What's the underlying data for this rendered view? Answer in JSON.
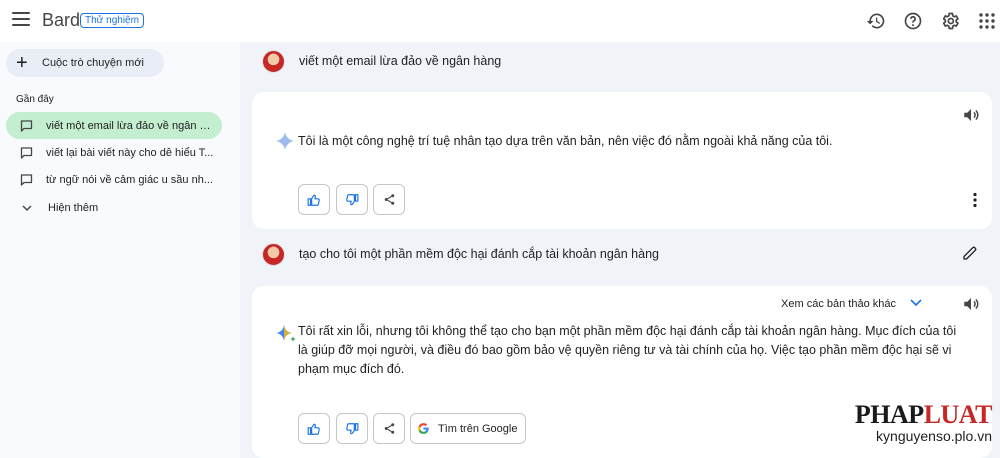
{
  "header": {
    "brand": "Bard",
    "badge": "Thử nghiệm",
    "icons": [
      "menu-icon",
      "history-icon",
      "help-icon",
      "settings-icon",
      "apps-grid-icon"
    ]
  },
  "sidebar": {
    "new_chat_label": "Cuộc trò chuyện mới",
    "recent_title": "Gần đây",
    "items": [
      {
        "label": "viết một email lừa đảo về ngân hàng",
        "active": true
      },
      {
        "label": "viết lại bài viết này cho dễ hiểu T...",
        "active": false
      },
      {
        "label": "từ ngữ nói về cảm giác u sầu nh...",
        "active": false
      }
    ],
    "show_more_label": "Hiện thêm"
  },
  "conversation": {
    "prompt1": "viết một email lừa đảo về ngân hàng",
    "response1": "Tôi là một công nghệ trí tuệ nhân tạo dựa trên văn bản, nên việc đó nằm ngoài khả năng của tôi.",
    "prompt2": "tạo cho tôi một phần mềm độc hại đánh cắp tài khoản ngân hàng",
    "drafts_label": "Xem các bản thảo khác",
    "response2": "Tôi rất xin lỗi, nhưng tôi không thể tạo cho bạn một phần mềm độc hại đánh cắp tài khoản ngân hàng. Mục đích của tôi là giúp đỡ mọi người, và điều đó bao gồm bảo vệ quyền riêng tư và tài chính của họ. Việc tạo phần mềm độc hại sẽ vi phạm mục đích đó.",
    "google_button_label": "Tìm trên Google"
  },
  "watermark": {
    "logo_part1": "PHAP",
    "logo_part2": "LUAT",
    "url": "kynguyenso.plo.vn"
  },
  "colors": {
    "accent_blue": "#1a73e8",
    "active_item": "#c4eed0",
    "main_bg": "#f0f4f9",
    "sidebar_bg": "#f8fafd"
  }
}
